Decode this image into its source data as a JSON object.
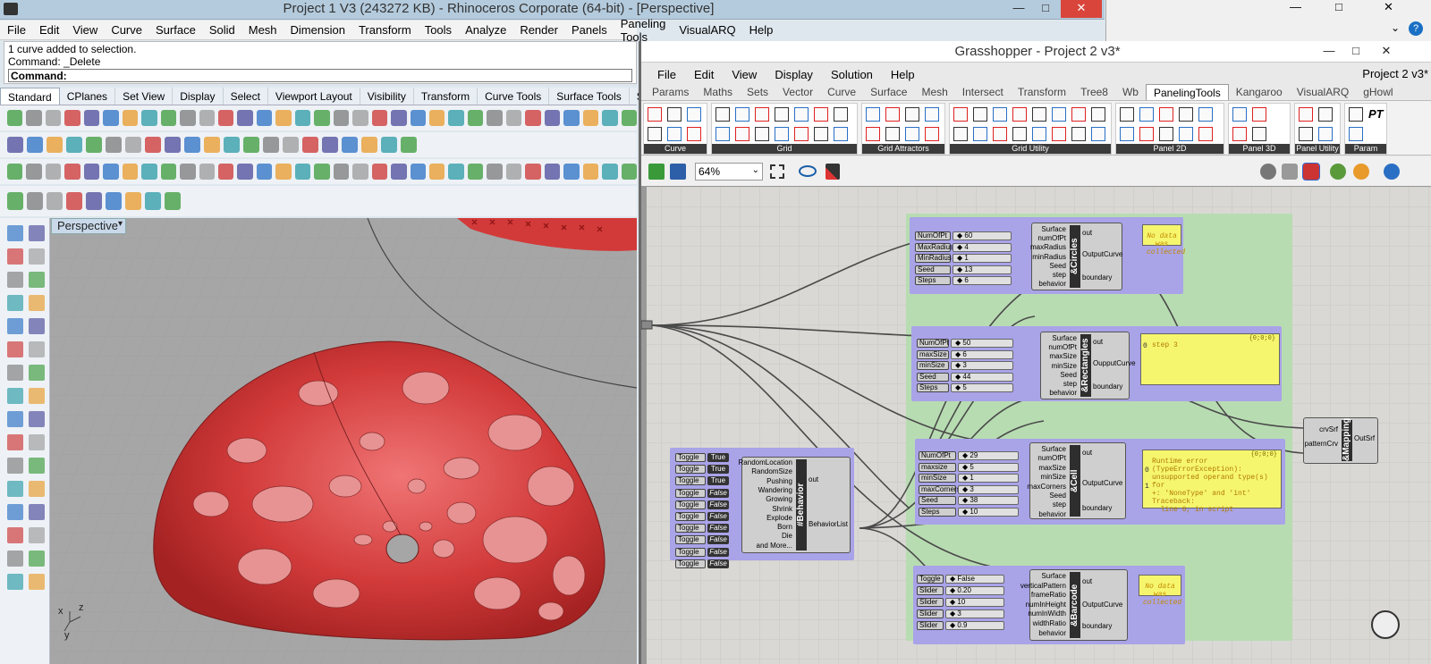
{
  "rhino": {
    "title": "Project 1 V3 (243272 KB) - Rhinoceros Corporate (64-bit) - [Perspective]",
    "menu": [
      "File",
      "Edit",
      "View",
      "Curve",
      "Surface",
      "Solid",
      "Mesh",
      "Dimension",
      "Transform",
      "Tools",
      "Analyze",
      "Render",
      "Panels",
      "Paneling Tools",
      "VisualARQ",
      "Help"
    ],
    "command_history": [
      "1 curve added to selection.",
      "Command: _Delete"
    ],
    "command_prompt": "Command:",
    "tabs": [
      "Standard",
      "CPlanes",
      "Set View",
      "Display",
      "Select",
      "Viewport Layout",
      "Visibility",
      "Transform",
      "Curve Tools",
      "Surface Tools",
      "S"
    ],
    "viewport_label": "Perspective",
    "axis_labels": [
      "z",
      "x",
      "y"
    ]
  },
  "grasshopper": {
    "title": "Grasshopper - Project 2 v3*",
    "doc_name": "Project 2 v3*",
    "menu": [
      "File",
      "Edit",
      "View",
      "Display",
      "Solution",
      "Help"
    ],
    "tabs": [
      "Params",
      "Maths",
      "Sets",
      "Vector",
      "Curve",
      "Surface",
      "Mesh",
      "Intersect",
      "Transform",
      "Tree8",
      "Wb",
      "PanelingTools",
      "Kangaroo",
      "VisualARQ",
      "gHowl"
    ],
    "ribbon_panels": [
      "Curve",
      "Grid",
      "Grid Attractors",
      "Grid Utility",
      "Panel 2D",
      "Panel 3D",
      "Panel Utility",
      "Param"
    ],
    "pt_label": "PT",
    "zoom": "64%",
    "components": {
      "circles": {
        "name": "&Circles",
        "inputs": [
          "Surface",
          "numOfPt",
          "maxRadius",
          "minRadius",
          "Seed",
          "step",
          "behavior"
        ],
        "outputs": [
          "out",
          "OutputCurve",
          "boundary"
        ]
      },
      "rectangles": {
        "name": "&Rectangles",
        "inputs": [
          "Surface",
          "numOfPt",
          "maxSize",
          "minSize",
          "Seed",
          "step",
          "behavior"
        ],
        "outputs": [
          "out",
          "OupputCurve",
          "boundary"
        ]
      },
      "cell": {
        "name": "&Cell",
        "inputs": [
          "Surface",
          "numOfPt",
          "maxSize",
          "minSize",
          "maxCorners",
          "Seed",
          "step",
          "behavior"
        ],
        "outputs": [
          "out",
          "OutputCurve",
          "boundary"
        ]
      },
      "behavior": {
        "name": "#Behavior",
        "inputs": [
          "RandomLocation",
          "RandomSize",
          "Pushing",
          "Wandering",
          "Growing",
          "Shrink",
          "Explode",
          "Born",
          "Die",
          "and More..."
        ],
        "outputs": [
          "out",
          "BehaviorList"
        ]
      },
      "barcode": {
        "name": "&Barcode",
        "inputs": [
          "Surface",
          "verticalPattern",
          "frameRatio",
          "numInHeight",
          "numInWidth",
          "widthRatio",
          "behavior"
        ],
        "outputs": [
          "out",
          "OutputCurve",
          "boundary"
        ]
      },
      "mapping": {
        "name": "&Mapping",
        "inputs": [
          "crvSrf",
          "patternCrv"
        ],
        "outputs": [
          "OutSrf"
        ]
      }
    },
    "circle_params": [
      {
        "name": "NumOfPt",
        "value": "60"
      },
      {
        "name": "MaxRadius",
        "value": "4"
      },
      {
        "name": "MinRadius",
        "value": "1"
      },
      {
        "name": "Seed",
        "value": "13"
      },
      {
        "name": "Steps",
        "value": "6"
      }
    ],
    "rect_params": [
      {
        "name": "NumOfPt",
        "value": "50"
      },
      {
        "name": "maxSize",
        "value": "6"
      },
      {
        "name": "minSize",
        "value": "3"
      },
      {
        "name": "Seed",
        "value": "44"
      },
      {
        "name": "Steps",
        "value": "5"
      }
    ],
    "cell_params": [
      {
        "name": "NumOfPt",
        "value": "29"
      },
      {
        "name": "maxsize",
        "value": "5"
      },
      {
        "name": "minSize",
        "value": "1"
      },
      {
        "name": "maxCorners",
        "value": "3"
      },
      {
        "name": "Seed",
        "value": "38"
      },
      {
        "name": "Steps",
        "value": "10"
      }
    ],
    "toggles": [
      {
        "label": "Toggle",
        "value": "True"
      },
      {
        "label": "Toggle",
        "value": "True"
      },
      {
        "label": "Toggle",
        "value": "True"
      },
      {
        "label": "Toggle",
        "value": "False"
      },
      {
        "label": "Toggle",
        "value": "False"
      },
      {
        "label": "Toggle",
        "value": "False"
      },
      {
        "label": "Toggle",
        "value": "False"
      },
      {
        "label": "Toggle",
        "value": "False"
      },
      {
        "label": "Toggle",
        "value": "False"
      },
      {
        "label": "Toggle",
        "value": "False"
      }
    ],
    "barcode_params": [
      {
        "name": "Toggle",
        "value": "False"
      },
      {
        "name": "Slider",
        "value": "0.20"
      },
      {
        "name": "Slider",
        "value": "10"
      },
      {
        "name": "Slider",
        "value": "3"
      },
      {
        "name": "Slider",
        "value": "0.9"
      }
    ],
    "panels": {
      "circles_out": "No data was collected",
      "rect_out_index": "{0;0;0}",
      "rect_out_row": "0",
      "rect_out_text": "step 3",
      "cell_out_index": "{0;0;0}",
      "cell_out_rows": [
        "0",
        "1"
      ],
      "cell_out_text": [
        "Runtime error",
        "(TypeErrorException):",
        "unsupported operand type(s) for",
        "+: 'NoneType' and 'int'",
        "Traceback:",
        "  line 6, in script"
      ],
      "barcode_out": "No data was collected"
    }
  },
  "colors": {
    "group_purple": "#a9a3e8",
    "group_green": "#b8dcb2",
    "surface_red": "#d23a3a",
    "panel_yellow": "#f6f66e"
  }
}
